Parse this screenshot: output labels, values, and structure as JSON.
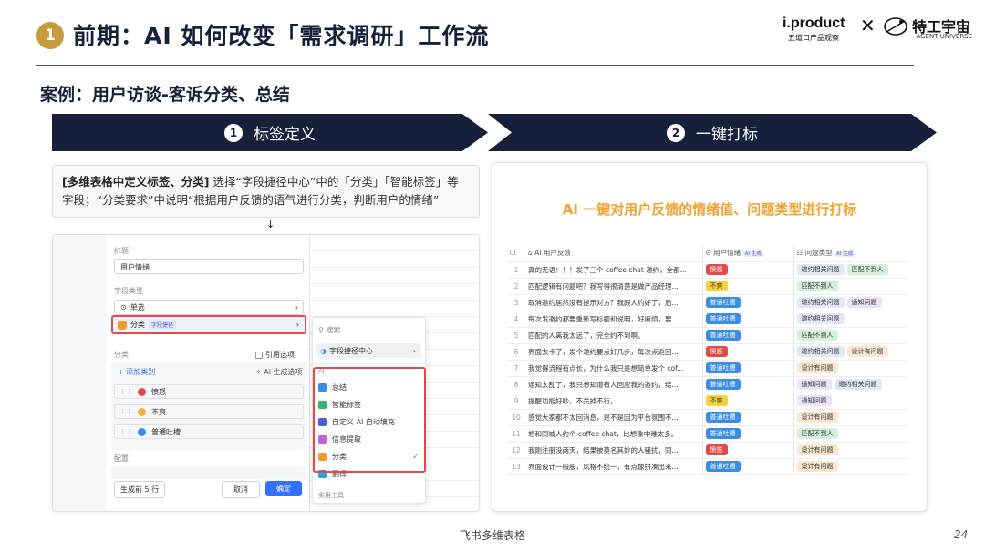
{
  "header": {
    "badge": "1",
    "title": "前期：AI 如何改变「需求调研」工作流",
    "logo_left": "i.product",
    "logo_left_sub": "五道口产品观察",
    "logo_x": "✕",
    "logo_right": "特工宇宙",
    "logo_right_sub": "· AGENT UNIVERSE ·"
  },
  "case_title": "案例：用户访谈-客诉分类、总结",
  "steps": [
    {
      "num": "1",
      "label": "标签定义"
    },
    {
      "num": "2",
      "label": "一键打标"
    }
  ],
  "desc": {
    "bold": "[多维表格中定义标签、分类]",
    "text": " 选择“字段捷径中心”中的「分类」「智能标签」等字段；“分类要求”中说明“根据用户反馈的语气进行分类，判断用户的情绪”",
    "arrow": "↓"
  },
  "left_form": {
    "title_label": "标题",
    "title_value": "用户情绪",
    "field_type_label": "字段类型",
    "type_single": "单选",
    "type_category": "分类",
    "type_category_tag": "字段捷径",
    "category_label": "分类",
    "ref_option": "引用选项",
    "add_category": "+ 添加类别",
    "ai_generate": "AI 生成选项",
    "categories": [
      {
        "name": "愤怒",
        "color": "#e04a4a"
      },
      {
        "name": "不爽",
        "color": "#f2b233"
      },
      {
        "name": "普通吐槽",
        "color": "#3a8de0"
      }
    ],
    "config_label": "配置",
    "gen_first": "生成前 5 行",
    "cancel": "取消",
    "confirm": "确定"
  },
  "popup": {
    "search": "搜索",
    "shortcut_center": "字段捷径中心",
    "ai_section": "AI",
    "items": [
      {
        "label": "总结",
        "color": "#3a8de0"
      },
      {
        "label": "智能标签",
        "color": "#37b36b"
      },
      {
        "label": "自定义 AI 自动填充",
        "color": "#4a5fd8"
      },
      {
        "label": "信息提取",
        "color": "#c062d9"
      },
      {
        "label": "分类",
        "color": "#f29a2e"
      },
      {
        "label": "翻译",
        "color": "#2fa3d8"
      }
    ],
    "footer_section": "实用工具",
    "check": "✓"
  },
  "right": {
    "title": "AI 一键对用户反馈的情绪值、问题类型进行打标",
    "columns": [
      "AI 用户反馈",
      "用户情绪",
      "问题类型"
    ],
    "ai_tag": "AI 生成",
    "rows": [
      {
        "n": "1",
        "text": "真的无语！！！发了三个 coffee chat 邀约，全都...",
        "emotion": "愤怒",
        "types": [
          "邀约相关问题",
          "匹配不到人"
        ]
      },
      {
        "n": "2",
        "text": "匹配逻辑有问题吧？我写得很清楚是做产品经理...",
        "emotion": "不爽",
        "types": [
          "匹配不到人"
        ]
      },
      {
        "n": "3",
        "text": "取消邀约居然没有提示对方？我跟人约好了，后...",
        "emotion": "普通吐槽",
        "types": [
          "邀约相关问题",
          "通知问题"
        ]
      },
      {
        "n": "4",
        "text": "每次发邀约都要重新写标题和说明，好麻烦，要...",
        "emotion": "普通吐槽",
        "types": [
          "邀约相关问题"
        ]
      },
      {
        "n": "5",
        "text": "匹配的人离我太远了，完全约不到啊。",
        "emotion": "普通吐槽",
        "types": [
          "匹配不到人"
        ]
      },
      {
        "n": "6",
        "text": "界面太卡了，发个邀约要点好几步，每次点返回...",
        "emotion": "愤怒",
        "types": [
          "邀约相关问题",
          "设计有问题"
        ]
      },
      {
        "n": "7",
        "text": "我觉得流程有点长，为什么我只是想简单发个 cof...",
        "emotion": "普通吐槽",
        "types": [
          "设计有问题"
        ]
      },
      {
        "n": "8",
        "text": "通知太乱了，我只想知道有人回应我的邀约，结...",
        "emotion": "普通吐槽",
        "types": [
          "通知问题",
          "邀约相关问题"
        ]
      },
      {
        "n": "9",
        "text": "提醒功能好吵，不关掉不行。",
        "emotion": "不爽",
        "types": [
          "通知问题"
        ]
      },
      {
        "n": "10",
        "text": "感觉大家都不太回消息，是不是因为平台氛围不...",
        "emotion": "普通吐槽",
        "types": [
          "设计有问题"
        ]
      },
      {
        "n": "11",
        "text": "想和同城人约个 coffee chat，比想象中难太多。",
        "emotion": "普通吐槽",
        "types": [
          "匹配不到人"
        ]
      },
      {
        "n": "12",
        "text": "我刚注册没两天，结果被莫名其妙的人骚扰，同...",
        "emotion": "愤怒",
        "types": [
          "设计有问题"
        ]
      },
      {
        "n": "13",
        "text": "界面设计一般般，风格不统一，有点像拼凑出来...",
        "emotion": "普通吐槽",
        "types": [
          "设计有问题"
        ]
      }
    ]
  },
  "colors": {
    "navy": "#17203a",
    "gold": "#c79b3b",
    "orange": "#f2a22e",
    "red": "#e04a4a"
  },
  "footer": "飞书多维表格",
  "page": "24"
}
